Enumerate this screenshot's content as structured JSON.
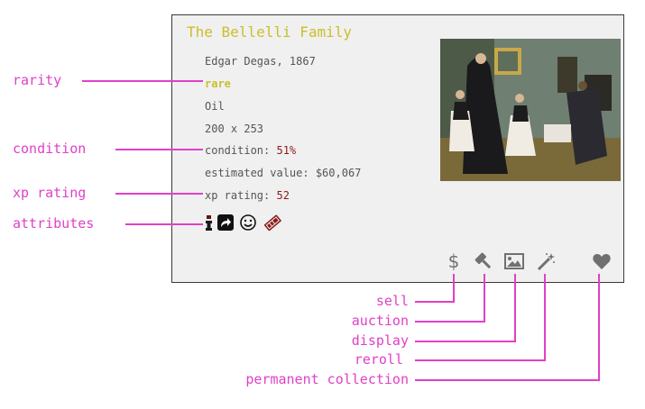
{
  "card": {
    "title": "The Bellelli Family",
    "artist_line": "Edgar Degas, 1867",
    "rarity": "rare",
    "medium": "Oil",
    "dimensions": "200 x 253",
    "condition_label": "condition: ",
    "condition_value": "51%",
    "value_label": "estimated value: ",
    "value_amount": "$60,067",
    "xp_label": "xp rating: ",
    "xp_value": "52",
    "attributes": [
      "info-icon",
      "share-arrow-icon",
      "smiley-icon",
      "ticket-icon"
    ],
    "actions": [
      "dollar-icon",
      "gavel-icon",
      "image-icon",
      "magic-wand-icon",
      "heart-icon"
    ]
  },
  "callouts": {
    "rarity": "rarity",
    "condition": "condition",
    "xp_rating": "xp rating",
    "attributes": "attributes",
    "sell": "sell",
    "auction": "auction",
    "display": "display",
    "reroll": "reroll",
    "permanent_collection": "permanent collection"
  },
  "colors": {
    "accent_title": "#c9bf2c",
    "callout": "#e040c8",
    "value_red": "#8b1a1a",
    "icon_gray": "#707070"
  }
}
